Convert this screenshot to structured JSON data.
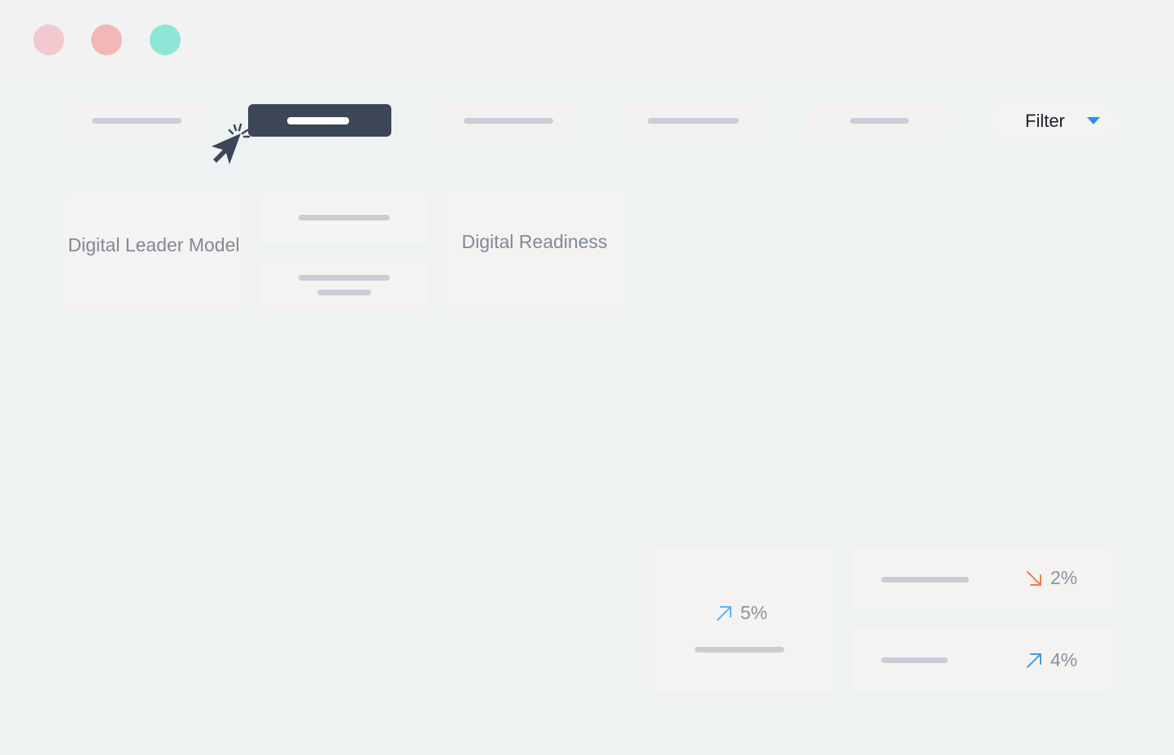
{
  "window": {
    "controls": [
      "close",
      "minimize",
      "maximize"
    ]
  },
  "tabs": [
    {
      "active": false
    },
    {
      "active": true
    },
    {
      "active": false
    },
    {
      "active": false
    },
    {
      "active": false
    }
  ],
  "filter": {
    "label": "Filter",
    "caret_icon": "caret-down-icon",
    "caret_color": "#2f8cf0"
  },
  "cards": {
    "digital_leader_model": {
      "title": "Digital Leader Model"
    },
    "digital_readiness": {
      "title": "Digital Readiness"
    }
  },
  "stats": {
    "main": {
      "value": "5%",
      "trend": "up",
      "icon": "arrow-up-right-icon",
      "color": "#5bb6f3"
    },
    "row1": {
      "value": "2%",
      "trend": "down",
      "icon": "arrow-down-right-icon",
      "color": "#f07a4a"
    },
    "row2": {
      "value": "4%",
      "trend": "up",
      "icon": "arrow-up-right-icon",
      "color": "#3f9de8"
    }
  },
  "cursor": {
    "icon": "click-cursor-icon",
    "color": "#3c4657"
  }
}
